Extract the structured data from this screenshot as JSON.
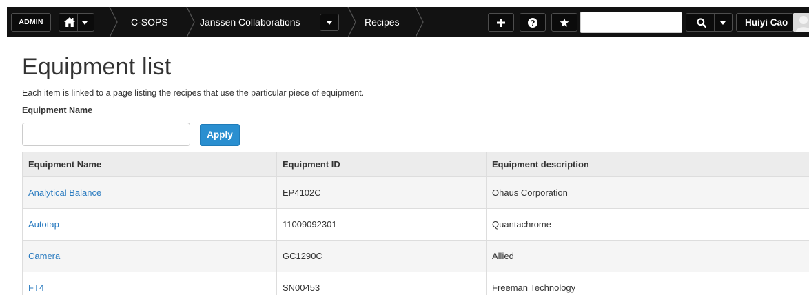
{
  "navbar": {
    "admin_label": "ADMIN",
    "breadcrumbs": [
      "C-SOPS",
      "Janssen Collaborations",
      "Recipes"
    ],
    "search_placeholder": "",
    "user_name": "Huiyi Cao",
    "icons": [
      "home-icon",
      "plus-icon",
      "help-icon",
      "star-icon",
      "search-icon",
      "user-avatar-icon"
    ]
  },
  "page": {
    "title": "Equipment list",
    "description": "Each item is linked to a page listing the recipes that use the particular piece of equipment.",
    "filter_label": "Equipment Name",
    "filter_value": "",
    "apply_label": "Apply"
  },
  "table": {
    "headers": [
      "Equipment Name",
      "Equipment ID",
      "Equipment description"
    ],
    "rows": [
      {
        "name": "Analytical Balance",
        "id": "EP4102C",
        "description": "Ohaus Corporation"
      },
      {
        "name": "Autotap",
        "id": "11009092301",
        "description": "Quantachrome"
      },
      {
        "name": "Camera",
        "id": "GC1290C",
        "description": "Allied"
      },
      {
        "name": "FT4",
        "id": "SN00453",
        "description": "Freeman Technology"
      }
    ]
  },
  "colors": {
    "navbar_bg": "#121212",
    "link": "#2a7bc0",
    "primary_button": "#2a8fd0"
  }
}
